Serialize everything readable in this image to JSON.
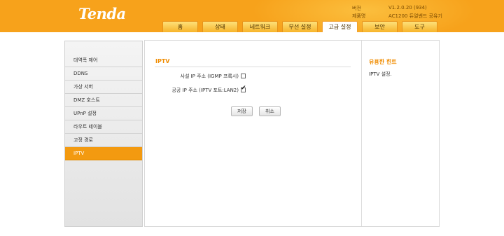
{
  "header": {
    "logo": "Tenda",
    "version_label": "버전",
    "version_value": "V1.2.0.20 (934)",
    "product_label": "제품명",
    "product_value": "AC1200 듀얼밴드 공유기"
  },
  "tabs": [
    "홈",
    "상태",
    "네트워크",
    "무선 설정",
    "고급 설정",
    "보안",
    "도구"
  ],
  "sidebar": {
    "items": [
      "대역폭 제어",
      "DDNS",
      "가상 서버",
      "DMZ 호스트",
      "UPnP 설정",
      "라우트 테이블",
      "고정 경로",
      "IPTV"
    ]
  },
  "main": {
    "section_title": "IPTV",
    "rows": [
      {
        "label": "사설 IP 주소 (IGMP 프록시)",
        "checked": false
      },
      {
        "label": "공공 IP 주소 (IPTV 포트:LAN2)",
        "checked": true
      }
    ],
    "save_label": "저장",
    "cancel_label": "취소"
  },
  "hint": {
    "title": "유용한 힌트",
    "text": "IPTV 설정."
  },
  "colors": {
    "accent": "#f7a21b",
    "active_item": "#f39a10",
    "title_orange": "#f08c00"
  }
}
